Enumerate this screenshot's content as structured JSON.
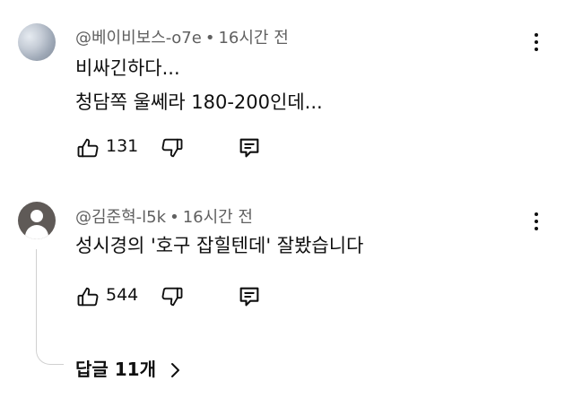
{
  "comments": [
    {
      "author": "@베이비보스-o7e",
      "separator": "•",
      "time": "16시간 전",
      "lines": [
        "비싸긴하다...",
        "청담쪽 울쎄라 180-200인데..."
      ],
      "like_count": "131"
    },
    {
      "author": "@김준혁-l5k",
      "separator": "•",
      "time": "16시간 전",
      "lines": [
        "성시경의 '호구 잡힐텐데' 잘봤습니다"
      ],
      "like_count": "544",
      "replies_label": "답글 11개"
    }
  ],
  "icons": {
    "avatar_1": "sky-photo-avatar",
    "avatar_2": "default-person-avatar",
    "like": "thumb-up-icon",
    "dislike": "thumb-down-icon",
    "reply": "reply-comment-icon",
    "more": "more-vertical-icon",
    "expand": "chevron-right-icon"
  },
  "colors": {
    "text": "#0f0f0f",
    "meta": "#606060",
    "thread_line": "#d0d0d0"
  }
}
